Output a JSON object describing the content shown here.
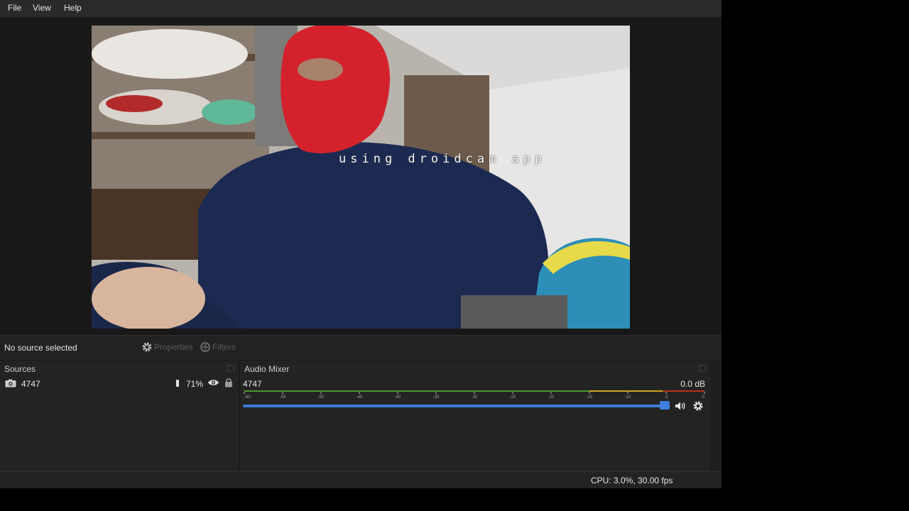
{
  "menu": {
    "file": "File",
    "view": "View",
    "help": "Help"
  },
  "preview": {
    "overlay_text": "using droidcam app"
  },
  "source_toolbar": {
    "status": "No source selected",
    "properties_label": "Properties",
    "filters_label": "Filters"
  },
  "sources": {
    "title": "Sources",
    "items": [
      {
        "name": "4747",
        "volume": "71%",
        "icon": "camera-icon",
        "visible": true,
        "locked": true
      }
    ]
  },
  "audio_mixer": {
    "title": "Audio Mixer",
    "channels": [
      {
        "name": "4747",
        "level": "0.0 dB",
        "fader_fraction": 0.99
      }
    ],
    "scale": [
      "-60",
      "-55",
      "-50",
      "-45",
      "-40",
      "-35",
      "-30",
      "-25",
      "-20",
      "-15",
      "-10",
      "-5",
      "0"
    ]
  },
  "status": {
    "cpu": "CPU: 3.0%, 30.00 fps"
  },
  "colors": {
    "fader": "#3a7bd5",
    "meter_green": "#4c9a2a",
    "meter_yellow": "#c8a61e",
    "meter_red": "#b5321f"
  }
}
